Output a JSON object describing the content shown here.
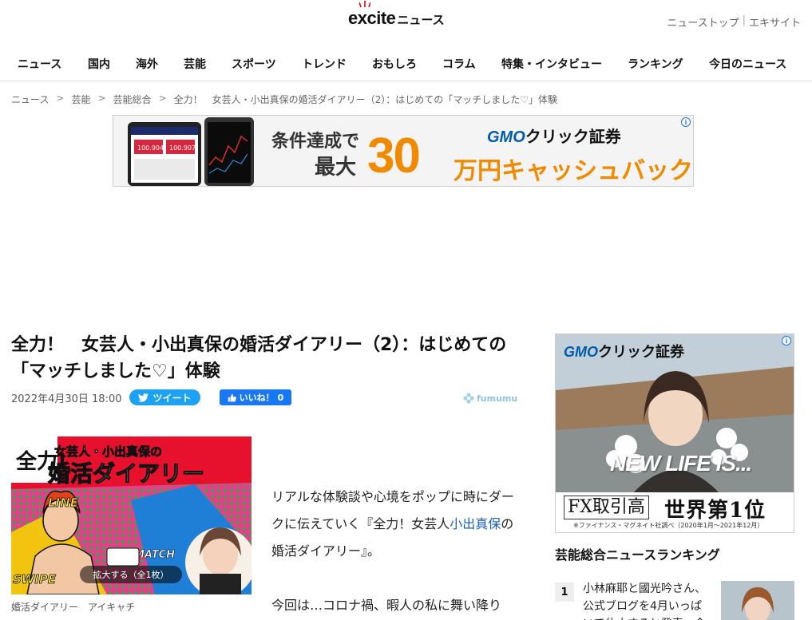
{
  "header": {
    "brand": "excite",
    "suffix": "ニュース",
    "top_links": [
      "ニューストップ",
      "エキサイト"
    ]
  },
  "gnav": [
    "ニュース",
    "国内",
    "海外",
    "芸能",
    "スポーツ",
    "トレンド",
    "おもしろ",
    "コラム",
    "特集・インタビュー",
    "ランキング",
    "今日のニュース"
  ],
  "breadcrumb": [
    "ニュース",
    "芸能",
    "芸能総合",
    "全力！　女芸人・小出真保の婚活ダイアリー（2）：はじめての「マッチしました♡」体験"
  ],
  "banner_ad": {
    "line1": "条件達成で",
    "line2": "最大",
    "amount": "30",
    "unit": "万円キャッシュバック!",
    "brand_latin": "GMO",
    "brand_jp": "クリック証券",
    "phone_values": [
      "100.904",
      "100.907"
    ]
  },
  "article": {
    "title": "全力！　女芸人・小出真保の婚活ダイアリー（2）：はじめての「マッチしました♡」体験",
    "date": "2022年4月30日 18:00",
    "tweet_label": "ツイート",
    "like_label": "いいね！",
    "like_count": "0",
    "source": "fumumu",
    "eyecatch_title_small": "女芸人・小出真保の",
    "eyecatch_title": "婚活ダイアリー",
    "eyecatch_kanji": "全力!",
    "eyecatch_stickers": [
      "LINE",
      "SWIPE",
      "MATCH"
    ],
    "zoom_label": "拡大する（全1枚）",
    "caption": "婚活ダイアリー　アイキャチ",
    "body_pre": "リアルな体験談や心境をポップに時にダークに伝えていく『全力！女芸人",
    "body_link": "小出真保",
    "body_post": "の婚活ダイアリー』。",
    "body2": "今回は…コロナ禍、暇人の私に舞い降り"
  },
  "side_ad": {
    "brand_latin": "GMO",
    "brand_jp": "クリック証券",
    "headline": "NEW LIFE IS...",
    "fx_label": "FX取引高",
    "fx_rank": "世界第1位",
    "fx_note": "※ファイナンス・マグネイト社調べ（2020年1月〜2021年12月）"
  },
  "ranking": {
    "heading": "芸能総合ニュースランキング",
    "items": [
      {
        "rank": "1",
        "text": "小林麻耶と國光吟さん、公式ブログを4月いっぱいで休止すると発表…今"
      }
    ]
  }
}
